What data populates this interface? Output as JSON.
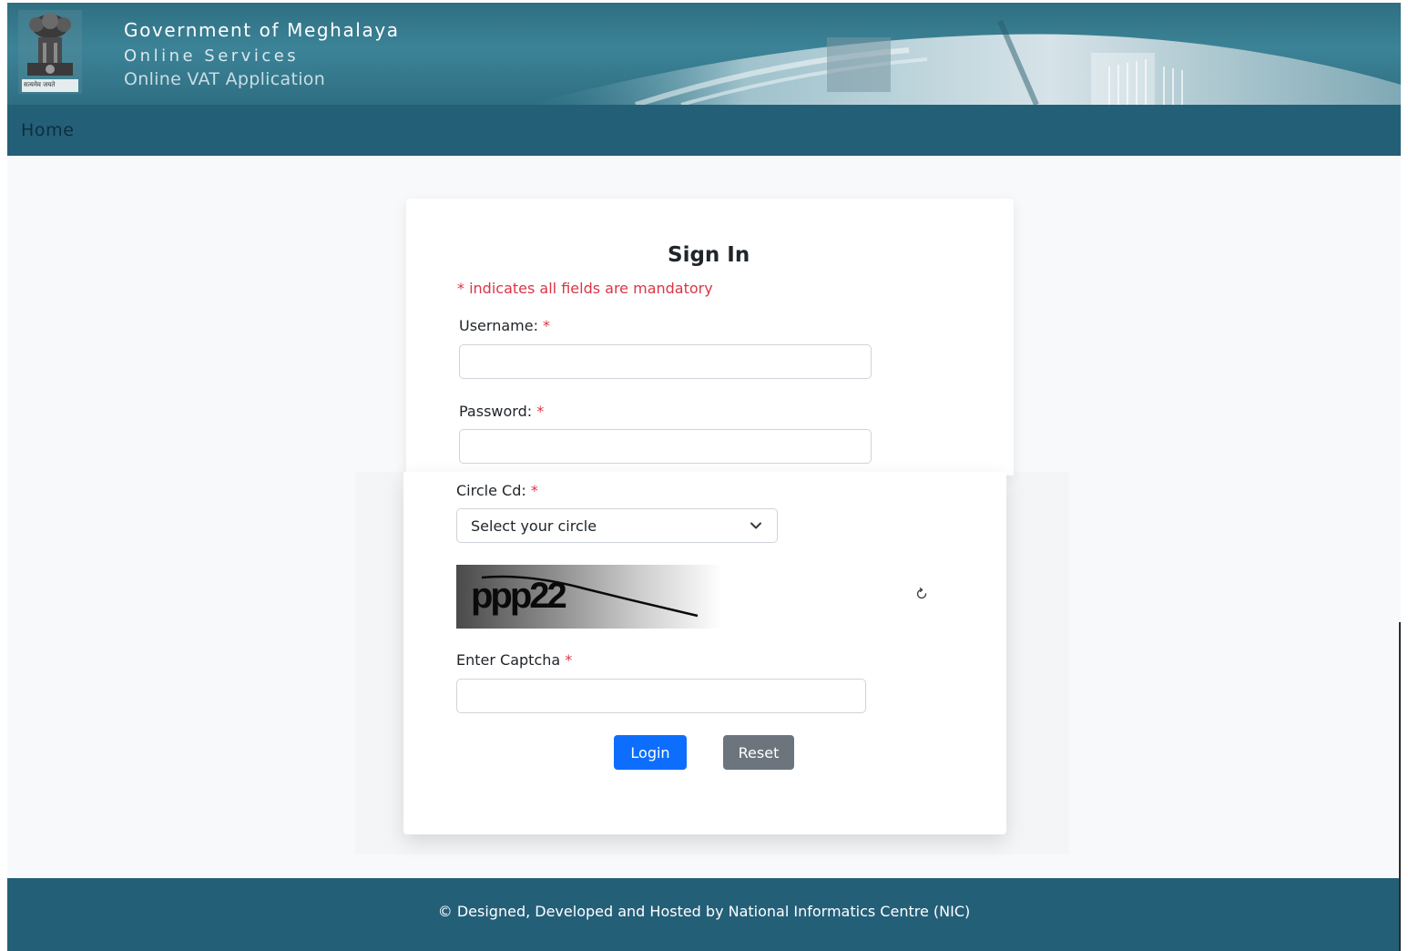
{
  "header": {
    "title": "Government of Meghalaya",
    "subtitle": "Online Services",
    "app_name": "Online VAT Application",
    "emblem_caption": "सत्यमेव जयते"
  },
  "nav": {
    "items": [
      {
        "label": "Home"
      }
    ]
  },
  "sign_in": {
    "title": "Sign In",
    "mandatory_note": "* indicates all fields are mandatory",
    "required_mark": "*",
    "username": {
      "label": "Username:",
      "value": "",
      "placeholder": ""
    },
    "password": {
      "label": "Password:",
      "value": "",
      "placeholder": ""
    },
    "circle": {
      "label": "Circle Cd:",
      "selected": "Select your circle"
    },
    "captcha": {
      "image_text": "ppp22",
      "label": "Enter Captcha",
      "value": ""
    },
    "buttons": {
      "login": "Login",
      "reset": "Reset"
    }
  },
  "footer": {
    "text": "© Designed, Developed and Hosted by National Informatics Centre (NIC)"
  },
  "colors": {
    "header_bg": "#3c8397",
    "nav_bg": "#245f78",
    "footer_bg": "#245f78",
    "required": "#dc3545",
    "login_button": "#0d6efd",
    "reset_button": "#6c757d"
  },
  "icons": {
    "select_indicator": "chevron-down-icon",
    "captcha_refresh": "refresh-icon",
    "state_emblem": "emblem-icon"
  }
}
